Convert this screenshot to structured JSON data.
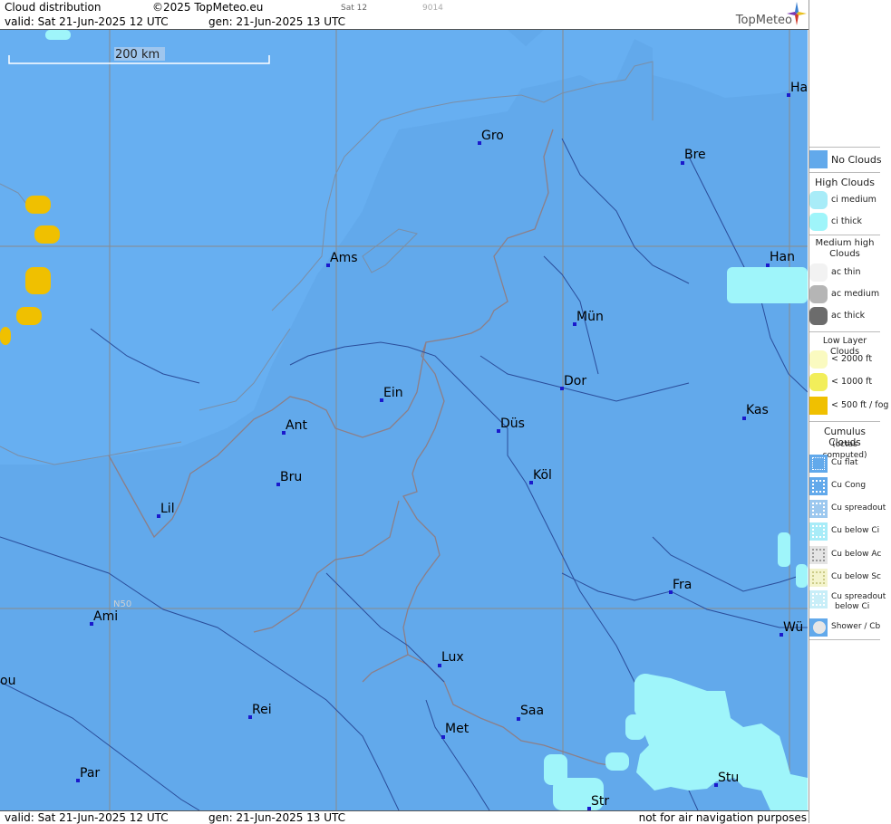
{
  "header": {
    "title": "Cloud distribution",
    "copyright": "©2025 TopMeteo.eu",
    "sat_label": "Sat 12",
    "code": "9014",
    "valid": "valid:  Sat  21-Jun-2025  12 UTC",
    "generated": "gen: 21-Jun-2025 13 UTC",
    "logo_text": "TopMeteo"
  },
  "footer": {
    "valid": "valid:  Sat  21-Jun-2025  12 UTC",
    "generated": "gen: 21-Jun-2025 13 UTC",
    "disclaimer": "not for air navigation purposes"
  },
  "map": {
    "scale_label": "200 km",
    "lat_label": "N50",
    "colors": {
      "sea": "#66aef0",
      "land": "#62a9eb",
      "ci_thick": "#9ff5fa",
      "low_fog": "#f0c000",
      "border": "#8c7f88",
      "river": "#2a4d9a",
      "grid": "#888888"
    },
    "cities": [
      {
        "name": "Gro"
      },
      {
        "name": "Bre"
      },
      {
        "name": "Ha"
      },
      {
        "name": "Ams"
      },
      {
        "name": "Han"
      },
      {
        "name": "Mün"
      },
      {
        "name": "Ein"
      },
      {
        "name": "Dor"
      },
      {
        "name": "Ant"
      },
      {
        "name": "Düs"
      },
      {
        "name": "Kas"
      },
      {
        "name": "Bru"
      },
      {
        "name": "Köl"
      },
      {
        "name": "Lil"
      },
      {
        "name": "Fra"
      },
      {
        "name": "Ami"
      },
      {
        "name": "Wü"
      },
      {
        "name": "Lux"
      },
      {
        "name": "ou"
      },
      {
        "name": "Rei"
      },
      {
        "name": "Saa"
      },
      {
        "name": "Met"
      },
      {
        "name": "Par"
      },
      {
        "name": "Stu"
      },
      {
        "name": "Str"
      }
    ]
  },
  "legend": {
    "no_clouds": "No Clouds",
    "high_title": "High Clouds",
    "ci_medium": "ci medium",
    "ci_thick": "ci thick",
    "medium_title": "Medium high Clouds",
    "ac_thin": "ac thin",
    "ac_medium": "ac medium",
    "ac_thick": "ac thick",
    "low_title": "Low Layer Clouds",
    "low_2000": "< 2000 ft",
    "low_1000": "< 1000 ft",
    "low_500": "< 500 ft / fog",
    "cu_title": "Cumulus Clouds",
    "cu_sub": "(octas computed)",
    "cu_flat": "Cu flat",
    "cu_cong": "Cu Cong",
    "cu_spread": "Cu spreadout",
    "cu_below_ci": "Cu below Ci",
    "cu_below_ac": "Cu below Ac",
    "cu_below_sc": "Cu below Sc",
    "cu_spread_below_ci_1": "Cu spreadout",
    "cu_spread_below_ci_2": "below Ci",
    "shower": "Shower / Cb"
  }
}
